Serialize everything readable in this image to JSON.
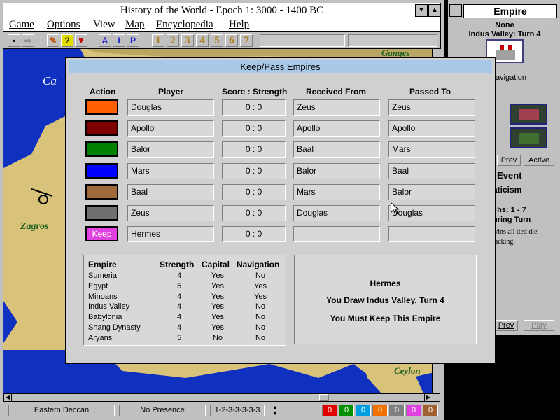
{
  "window": {
    "title": "History of the World - Epoch 1: 3000 - 1400 BC"
  },
  "menu": [
    "Game",
    "Options",
    "View",
    "Map",
    "Encyclopedia",
    "Help"
  ],
  "toolbar": {
    "numbers": [
      "1",
      "2",
      "3",
      "4",
      "5",
      "6",
      "7"
    ],
    "letters": [
      "A",
      "I",
      "P"
    ]
  },
  "map_labels": {
    "caspian": "Ca",
    "zagros": "Zagros",
    "ganges": "Ganges",
    "ceylon": "Ceylon"
  },
  "status": {
    "region": "Eastern Deccan",
    "presence": "No Presence",
    "sequence": "1-2-3-3-3-3-3",
    "counters": [
      "0",
      "0",
      "0",
      "0",
      "0",
      "0",
      "0"
    ],
    "counter_colors": [
      "#e00000",
      "#009000",
      "#00a0e0",
      "#f07000",
      "#808080",
      "#e040e0",
      "#a06030"
    ]
  },
  "empire_panel": {
    "title": "Empire",
    "capital": "None",
    "empire_turn": "Indus Valley: Turn 4",
    "navigation_fragment": "avigation",
    "prev_label": "Prev",
    "active_label": "Active"
  },
  "event_panel": {
    "title": "Event",
    "heading": "aticism",
    "epochs": "chs: 1 - 7",
    "during": "uring Turn",
    "text1": "wins all tied die",
    "text2": "tacking.",
    "prev_label": "Prev",
    "play_label": "Play"
  },
  "dialog": {
    "title": "Keep/Pass Empires",
    "headers": {
      "action": "Action",
      "player": "Player",
      "score": "Score : Strength",
      "received": "Received From",
      "passed": "Passed To"
    },
    "rows": [
      {
        "color": "#ff6000",
        "action": "",
        "player": "Douglas",
        "score": "0 : 0",
        "received": "Zeus",
        "passed": "Zeus"
      },
      {
        "color": "#800000",
        "action": "",
        "player": "Apollo",
        "score": "0 : 0",
        "received": "Apollo",
        "passed": "Apollo"
      },
      {
        "color": "#008000",
        "action": "",
        "player": "Balor",
        "score": "0 : 0",
        "received": "Baal",
        "passed": "Mars"
      },
      {
        "color": "#0000ff",
        "action": "",
        "player": "Mars",
        "score": "0 : 0",
        "received": "Balor",
        "passed": "Baal"
      },
      {
        "color": "#a06a3a",
        "action": "",
        "player": "Baal",
        "score": "0 : 0",
        "received": "Mars",
        "passed": "Balor"
      },
      {
        "color": "#707070",
        "action": "",
        "player": "Zeus",
        "score": "0 : 0",
        "received": "Douglas",
        "passed": "Douglas"
      },
      {
        "color": "#e040e0",
        "action": "Keep",
        "player": "Hermes",
        "score": "0 : 0",
        "received": "",
        "passed": ""
      }
    ],
    "empire_table": {
      "headers": {
        "empire": "Empire",
        "strength": "Strength",
        "capital": "Capital",
        "navigation": "Navigation"
      },
      "rows": [
        {
          "empire": "Sumeria",
          "strength": "4",
          "capital": "Yes",
          "navigation": "No"
        },
        {
          "empire": "Egypt",
          "strength": "5",
          "capital": "Yes",
          "navigation": "Yes"
        },
        {
          "empire": "Minoans",
          "strength": "4",
          "capital": "Yes",
          "navigation": "Yes"
        },
        {
          "empire": "Indus Valley",
          "strength": "4",
          "capital": "Yes",
          "navigation": "No"
        },
        {
          "empire": "Babylonia",
          "strength": "4",
          "capital": "Yes",
          "navigation": "No"
        },
        {
          "empire": "Shang Dynasty",
          "strength": "4",
          "capital": "Yes",
          "navigation": "No"
        },
        {
          "empire": "Aryans",
          "strength": "5",
          "capital": "No",
          "navigation": "No"
        }
      ]
    },
    "message": {
      "player": "Hermes",
      "line1": "You Draw Indus Valley, Turn 4",
      "line2": "You Must Keep This Empire"
    }
  }
}
